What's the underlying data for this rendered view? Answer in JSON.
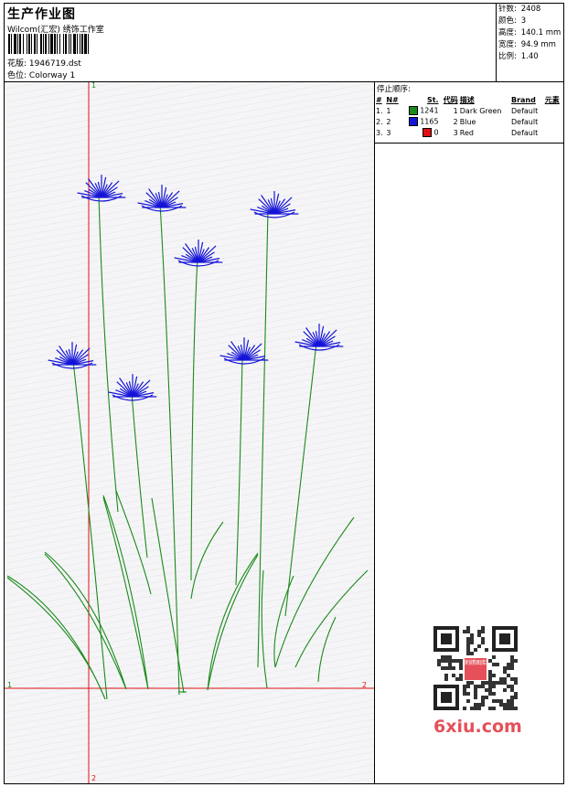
{
  "header": {
    "title": "生产作业图",
    "company": "Wilcom(汇宏) 绣饰工作室",
    "design_label": "花版:",
    "design_value": "1946719.dst",
    "colorway_label": "色位:",
    "colorway_value": "Colorway 1"
  },
  "stats": [
    {
      "label": "针数:",
      "value": "2408"
    },
    {
      "label": "颜色:",
      "value": "3"
    },
    {
      "label": "高度:",
      "value": "140.1 mm"
    },
    {
      "label": "宽度:",
      "value": "94.9 mm"
    },
    {
      "label": "比例:",
      "value": "1.40"
    }
  ],
  "stop_sequence": {
    "title": "停止顺序:",
    "headers": [
      "#",
      "N#",
      "St.",
      "代码",
      "描述",
      "Brand",
      "元素"
    ],
    "rows": [
      {
        "idx": "1.",
        "n": "1",
        "color": "#1a8a1a",
        "stitches": "1241",
        "code": "1",
        "desc": "Dark Green",
        "brand": "Default"
      },
      {
        "idx": "2.",
        "n": "2",
        "color": "#1414d8",
        "stitches": "1165",
        "code": "2",
        "desc": "Blue",
        "brand": "Default"
      },
      {
        "idx": "3.",
        "n": "3",
        "color": "#e01010",
        "stitches": "0",
        "code": "3",
        "desc": "Red",
        "brand": "Default"
      }
    ]
  },
  "axes": {
    "v_top": "1",
    "h_left": "1",
    "h_right": "2",
    "v_bottom": "2"
  },
  "watermark": {
    "text": "6xiu.com",
    "badge": "刺绣图库"
  },
  "colors": {
    "stem": "#1a8a1a",
    "flower": "#1414d8",
    "axis": "#e01010"
  }
}
